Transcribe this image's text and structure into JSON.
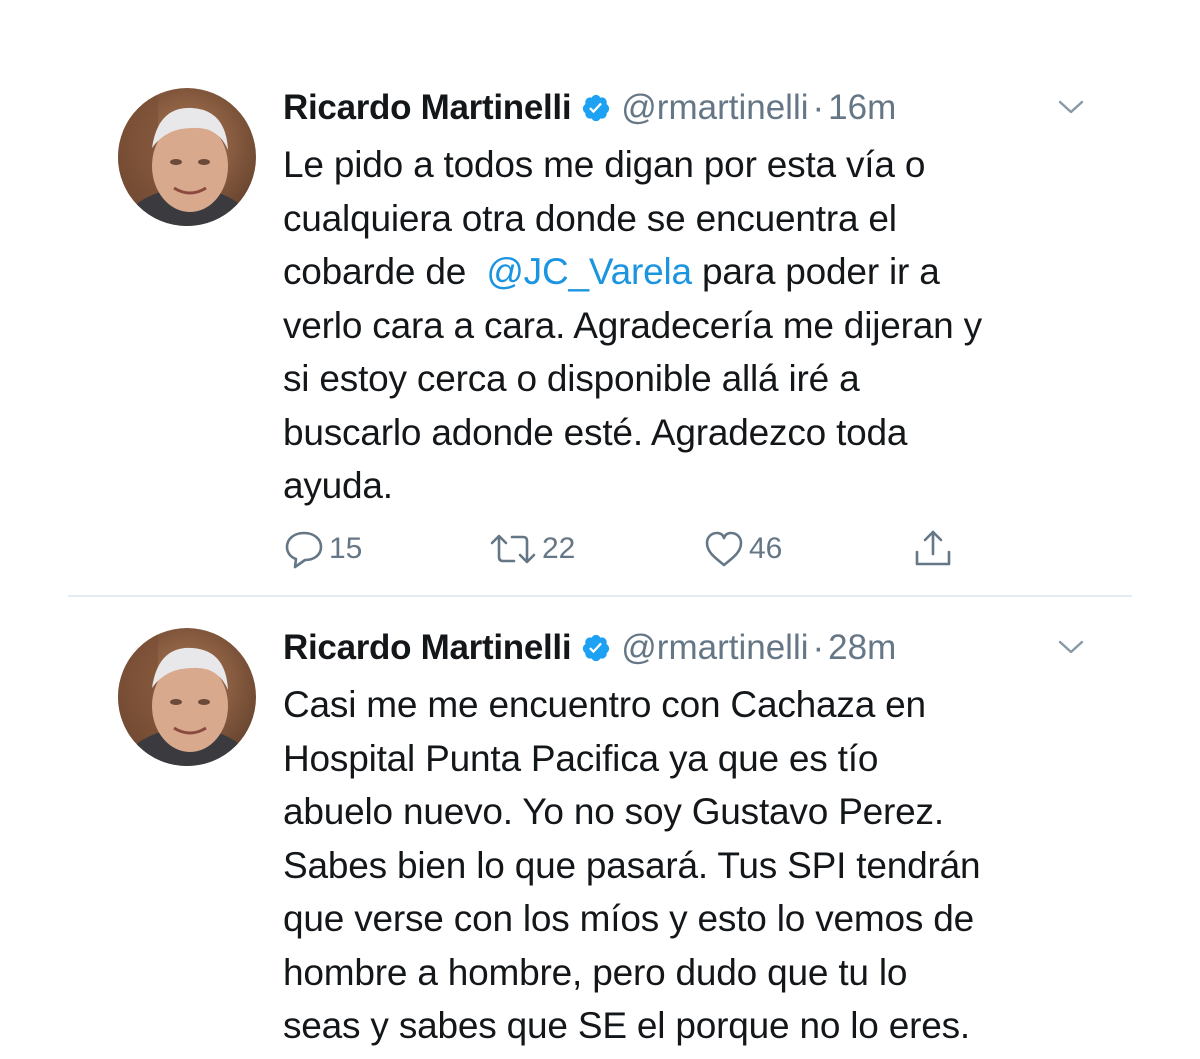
{
  "tweets": [
    {
      "author_name": "Ricardo Martinelli",
      "handle": "@rmartinelli",
      "separator": "·",
      "time": "16m",
      "avatar_icon": "user-avatar-photo",
      "verified_icon": "verified-badge-icon",
      "text_lines": [
        {
          "parts": [
            {
              "t": "Le pido a todos me digan por esta vía o"
            }
          ]
        },
        {
          "parts": [
            {
              "t": "cualquiera otra donde se encuentra el"
            }
          ]
        },
        {
          "parts": [
            {
              "t": "cobarde de  "
            },
            {
              "t": "@JC_Varela",
              "mention": true
            },
            {
              "t": " para poder ir a"
            }
          ]
        },
        {
          "parts": [
            {
              "t": "verlo cara a cara. Agradecería me dijeran y"
            }
          ]
        },
        {
          "parts": [
            {
              "t": "si estoy cerca o disponible allá iré a"
            }
          ]
        },
        {
          "parts": [
            {
              "t": "buscarlo adonde esté. Agradezco toda"
            }
          ]
        },
        {
          "parts": [
            {
              "t": "ayuda."
            }
          ]
        }
      ],
      "actions": {
        "replies": "15",
        "retweets": "22",
        "likes": "46"
      }
    },
    {
      "author_name": "Ricardo Martinelli",
      "handle": "@rmartinelli",
      "separator": "·",
      "time": "28m",
      "avatar_icon": "user-avatar-photo",
      "verified_icon": "verified-badge-icon",
      "text_lines": [
        {
          "parts": [
            {
              "t": "Casi me me encuentro con Cachaza en"
            }
          ]
        },
        {
          "parts": [
            {
              "t": "Hospital Punta Pacifica ya que es tío"
            }
          ]
        },
        {
          "parts": [
            {
              "t": "abuelo nuevo. Yo no soy Gustavo Perez."
            }
          ]
        },
        {
          "parts": [
            {
              "t": "Sabes bien lo que pasará. Tus SPI tendrán"
            }
          ]
        },
        {
          "parts": [
            {
              "t": "que verse con los míos y esto lo vemos de"
            }
          ]
        },
        {
          "parts": [
            {
              "t": "hombre a hombre, pero dudo que tu lo"
            }
          ]
        },
        {
          "parts": [
            {
              "t": "seas y sabes que SE el porque no lo eres."
            }
          ]
        }
      ]
    }
  ],
  "colors": {
    "text": "#14171a",
    "secondary": "#657786",
    "link": "#1b95e0",
    "verified": "#1da1f2",
    "divider": "#e6ecf0"
  }
}
